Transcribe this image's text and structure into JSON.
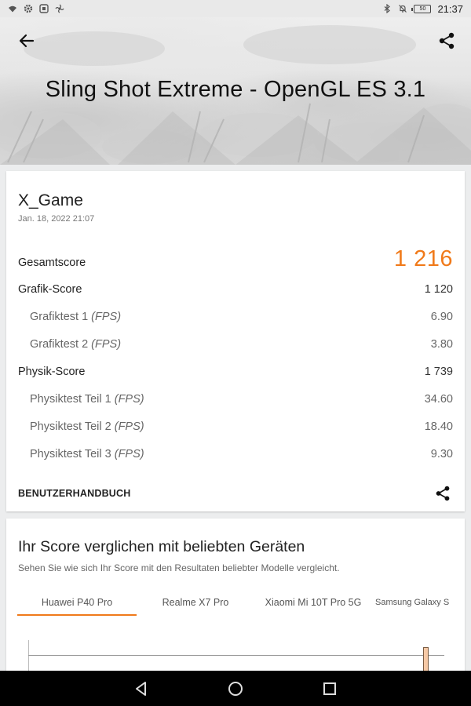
{
  "status": {
    "time": "21:37",
    "battery": "50"
  },
  "header": {
    "title": "Sling Shot Extreme - OpenGL ES 3.1"
  },
  "result": {
    "device": "X_Game",
    "date": "Jan. 18, 2022 21:07",
    "total_label": "Gesamtscore",
    "total_value": "1 216",
    "graphics_label": "Grafik-Score",
    "graphics_value": "1 120",
    "gt1_label": "Grafiktest 1",
    "gt1_value": "6.90",
    "gt2_label": "Grafiktest 2",
    "gt2_value": "3.80",
    "physics_label": "Physik-Score",
    "physics_value": "1 739",
    "pt1_label": "Physiktest Teil 1",
    "pt1_value": "34.60",
    "pt2_label": "Physiktest Teil 2",
    "pt2_value": "18.40",
    "pt3_label": "Physiktest Teil 3",
    "pt3_value": "9.30",
    "fps_unit": "(FPS)",
    "manual_link": "BENUTZERHANDBUCH"
  },
  "compare": {
    "title": "Ihr Score verglichen mit beliebten Geräten",
    "subtitle": "Sehen Sie wie sich Ihr Score mit den Resultaten beliebter Modelle vergleicht.",
    "tabs": [
      "Huawei P40 Pro",
      "Realme X7 Pro",
      "Xiaomi Mi 10T Pro 5G",
      "Samsung Galaxy S"
    ],
    "active_tab": 0
  },
  "colors": {
    "accent": "#f07a1a"
  }
}
